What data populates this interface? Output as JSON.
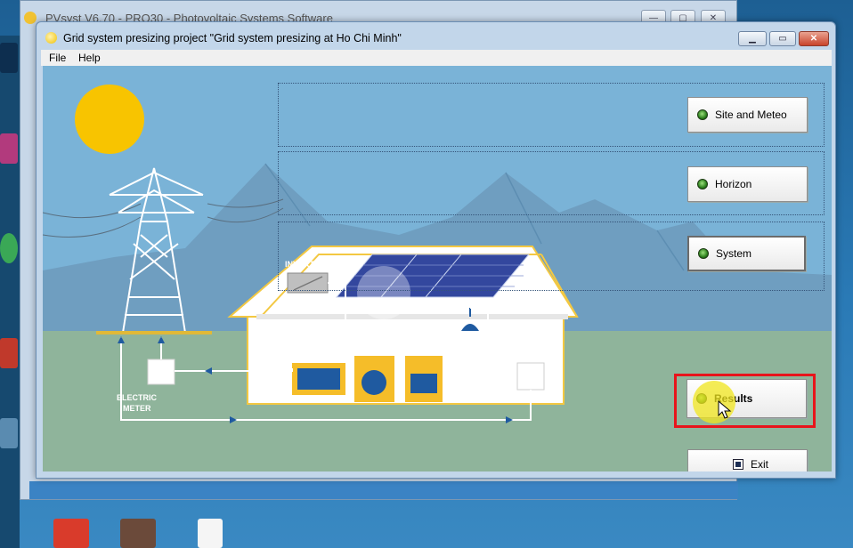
{
  "background_window": {
    "title": "PVsyst V6.70 - PRO30 - Photovoltaic Systems Software"
  },
  "window": {
    "title": "Grid system presizing project  \"Grid system presizing  at  Ho Chi Minh\""
  },
  "menu": {
    "items": [
      {
        "label": "File"
      },
      {
        "label": "Help"
      }
    ]
  },
  "scene": {
    "inverter_label": "INVERTER",
    "electric_meter_house_label": [
      "ELECTRIC",
      "METER"
    ],
    "electric_meter_grid_label": [
      "ELECTRIC",
      "METER"
    ]
  },
  "buttons": {
    "site_meteo": "Site and Meteo",
    "horizon": "Horizon",
    "system": "System",
    "results": "Results",
    "exit": "Exit"
  },
  "colors": {
    "sky": "#7ab3d7",
    "ground": "#8fb49b",
    "house_outline": "#f3c842",
    "highlight": "#e8141b",
    "led_green": "#3a9b24"
  }
}
